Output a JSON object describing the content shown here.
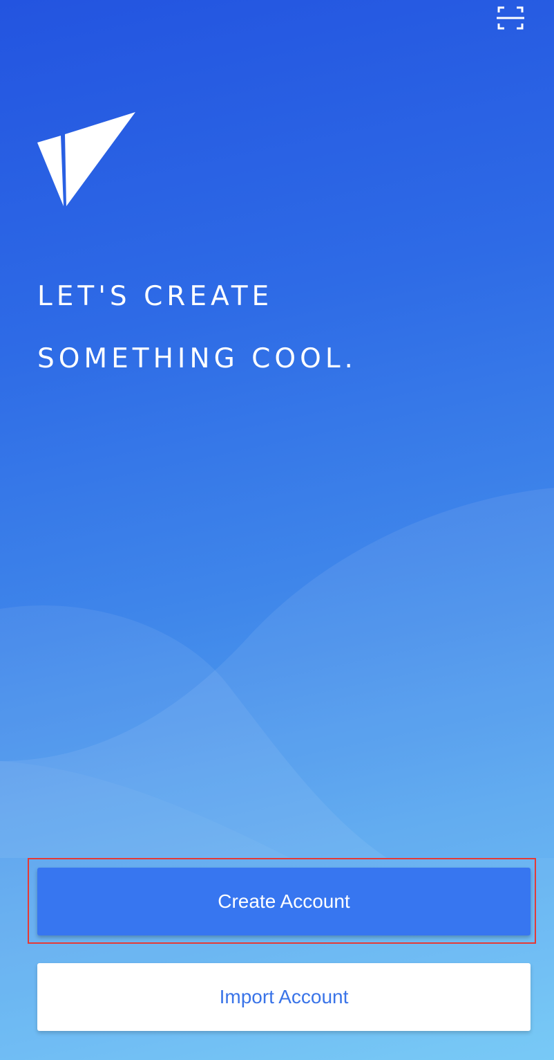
{
  "header": {
    "scan_icon": "scan-qr-icon"
  },
  "brand": {
    "logo_icon": "paper-plane-logo-icon"
  },
  "hero": {
    "line1": "LET'S CREATE",
    "line2": "SOMETHING COOL."
  },
  "actions": {
    "create_label": "Create Account",
    "import_label": "Import Account"
  },
  "colors": {
    "gradient_top": "#2354e0",
    "gradient_bottom": "#67c3f6",
    "primary_button": "#3776f0",
    "secondary_button_text": "#3a74e8",
    "highlight_border": "#e53935"
  }
}
